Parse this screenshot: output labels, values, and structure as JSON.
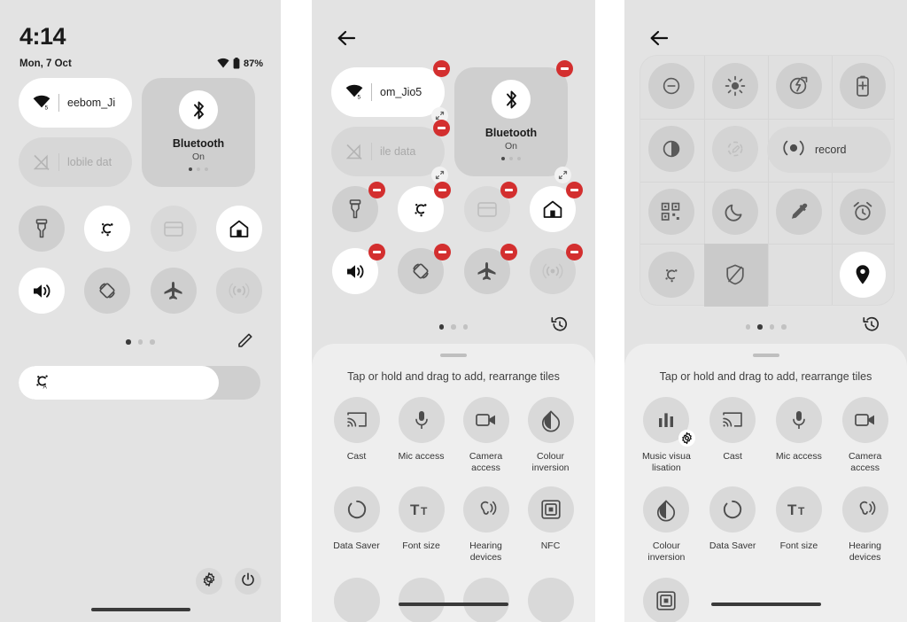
{
  "panel1": {
    "status": {
      "clock": "4:14",
      "date": "Mon, 7 Oct",
      "battery": "87%",
      "wifi_icon": "wifi-icon",
      "battery_icon": "battery-icon"
    },
    "wifi_tile": {
      "label": "eebom_Ji",
      "state": "on",
      "icon": "wifi-icon"
    },
    "mobile_tile": {
      "label": "lobile dat",
      "state": "off",
      "icon": "mobile-data-off-icon"
    },
    "bluetooth_tile": {
      "label": "Bluetooth",
      "state": "On",
      "icon": "bluetooth-icon",
      "page_dots": 3,
      "active_dot": 0
    },
    "tiles": [
      {
        "name": "flashlight",
        "icon": "flashlight-icon",
        "state": "off"
      },
      {
        "name": "auto-rotate-brightness",
        "icon": "celsius-icon",
        "state": "on"
      },
      {
        "name": "wallet",
        "icon": "wallet-icon",
        "state": "dim"
      },
      {
        "name": "home",
        "icon": "home-icon",
        "state": "on"
      },
      {
        "name": "sound",
        "icon": "volume-icon",
        "state": "on"
      },
      {
        "name": "auto-rotate",
        "icon": "auto-rotate-icon",
        "state": "off"
      },
      {
        "name": "airplane-mode",
        "icon": "airplane-icon",
        "state": "off"
      },
      {
        "name": "hotspot",
        "icon": "hotspot-icon",
        "state": "fade"
      }
    ],
    "pager": {
      "dots": 3,
      "active": 0,
      "action_icon": "pencil-icon"
    },
    "brightness": {
      "icon": "brightness-auto-icon",
      "percent": 83
    },
    "footer": [
      {
        "name": "settings",
        "icon": "gear-icon"
      },
      {
        "name": "power",
        "icon": "power-icon"
      }
    ]
  },
  "panel2": {
    "back_icon": "back-arrow-icon",
    "wifi_tile": {
      "label": "om_Jio5",
      "state": "on",
      "icon": "wifi-icon"
    },
    "mobile_tile": {
      "label": "ile data",
      "state": "off",
      "icon": "mobile-data-off-icon"
    },
    "bluetooth_tile": {
      "label": "Bluetooth",
      "state": "On",
      "icon": "bluetooth-icon",
      "page_dots": 3,
      "active_dot": 0
    },
    "tiles": [
      {
        "name": "flashlight",
        "icon": "flashlight-icon",
        "state": "off"
      },
      {
        "name": "auto-rotate-brightness",
        "icon": "celsius-icon",
        "state": "on"
      },
      {
        "name": "wallet",
        "icon": "wallet-icon",
        "state": "dim"
      },
      {
        "name": "home",
        "icon": "home-icon",
        "state": "on"
      },
      {
        "name": "sound",
        "icon": "volume-icon",
        "state": "on"
      },
      {
        "name": "auto-rotate",
        "icon": "auto-rotate-icon",
        "state": "off"
      },
      {
        "name": "airplane-mode",
        "icon": "airplane-icon",
        "state": "off"
      },
      {
        "name": "hotspot",
        "icon": "hotspot-icon",
        "state": "fade"
      }
    ],
    "pager": {
      "dots": 3,
      "active": 0,
      "action_icon": "restore-history-icon"
    },
    "drawer": {
      "hint": "Tap or hold and drag to add, rearrange tiles",
      "items": [
        {
          "label": "Cast",
          "icon": "cast-icon"
        },
        {
          "label": "Mic access",
          "icon": "microphone-icon"
        },
        {
          "label": "Camera access",
          "icon": "camera-icon"
        },
        {
          "label": "Colour inversion",
          "icon": "colour-inversion-icon"
        },
        {
          "label": "Data Saver",
          "icon": "data-saver-icon"
        },
        {
          "label": "Font size",
          "icon": "font-size-icon"
        },
        {
          "label": "Hearing devices",
          "icon": "hearing-devices-icon"
        },
        {
          "label": "NFC",
          "icon": "nfc-icon"
        }
      ]
    }
  },
  "panel3": {
    "back_icon": "back-arrow-icon",
    "tiles": [
      {
        "name": "dnd",
        "icon": "do-not-disturb-icon",
        "state": "off"
      },
      {
        "name": "brightness",
        "icon": "brightness-icon",
        "state": "off"
      },
      {
        "name": "battery-share",
        "icon": "battery-share-icon",
        "state": "off"
      },
      {
        "name": "battery-saver",
        "icon": "battery-saver-icon",
        "state": "off"
      },
      {
        "name": "dark-theme",
        "icon": "dark-theme-icon",
        "state": "off"
      },
      {
        "name": "location-off",
        "icon": "location-scan-icon",
        "state": "fade"
      },
      {
        "name": "screen-record",
        "icon": "screen-record-icon",
        "state": "off",
        "label": "record",
        "wide": true
      },
      {
        "name": "qr-scanner",
        "icon": "qr-code-icon",
        "state": "off"
      },
      {
        "name": "bedtime",
        "icon": "moon-icon",
        "state": "off"
      },
      {
        "name": "colour-picker",
        "icon": "eyedropper-icon",
        "state": "off"
      },
      {
        "name": "alarm",
        "icon": "alarm-icon",
        "state": "off"
      },
      {
        "name": "adaptive-brightness",
        "icon": "celsius-icon",
        "state": "off"
      },
      {
        "name": "privacy-shield",
        "icon": "shield-icon",
        "state": "highlight"
      },
      {
        "name": "empty-slot",
        "icon": "",
        "state": "empty"
      },
      {
        "name": "location",
        "icon": "location-pin-icon",
        "state": "on"
      }
    ],
    "pager": {
      "dots": 4,
      "active": 1,
      "action_icon": "restore-history-icon"
    },
    "drawer": {
      "hint": "Tap or hold and drag to add, rearrange tiles",
      "items": [
        {
          "label": "Music visua lisation",
          "icon": "music-visualisation-icon",
          "badge": "gear-icon"
        },
        {
          "label": "Cast",
          "icon": "cast-icon"
        },
        {
          "label": "Mic access",
          "icon": "microphone-icon"
        },
        {
          "label": "Camera access",
          "icon": "camera-icon"
        },
        {
          "label": "Colour inversion",
          "icon": "colour-inversion-icon"
        },
        {
          "label": "Data Saver",
          "icon": "data-saver-icon"
        },
        {
          "label": "Font size",
          "icon": "font-size-icon"
        },
        {
          "label": "Hearing devices",
          "icon": "hearing-devices-icon"
        },
        {
          "label": "",
          "icon": "nfc-icon"
        }
      ]
    }
  },
  "colors": {
    "panel_bg": "#e3e3e3",
    "tile_on": "#ffffff",
    "tile_off": "#cfcfcf",
    "accent_remove": "#d32f2f",
    "drawer_bg": "#eeeeee",
    "text": "#1b1b1b"
  }
}
